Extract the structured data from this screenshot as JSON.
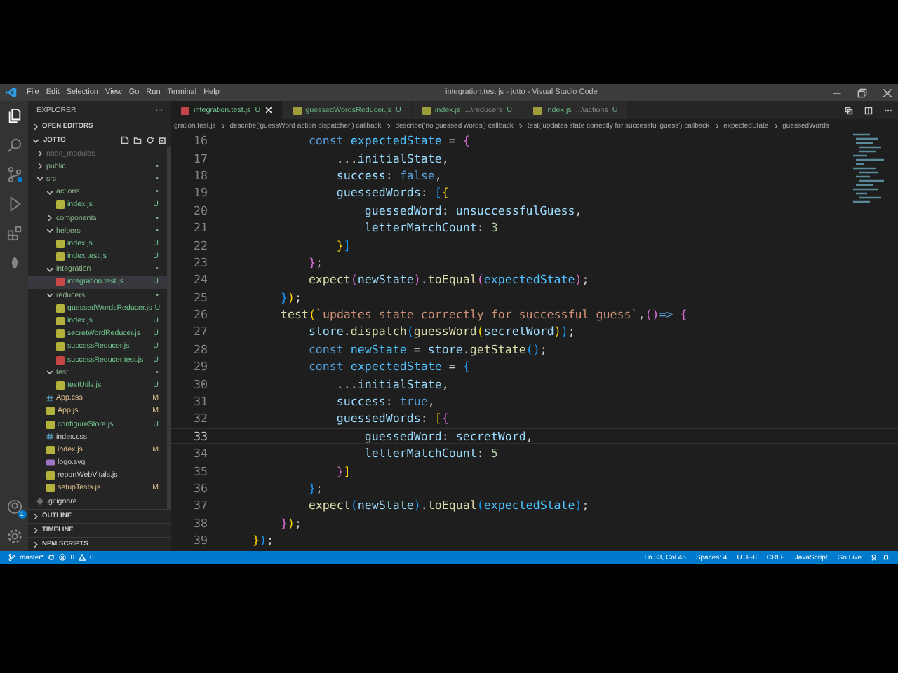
{
  "window": {
    "title": "integration.test.js - jotto - Visual Studio Code"
  },
  "menu": [
    "File",
    "Edit",
    "Selection",
    "View",
    "Go",
    "Run",
    "Terminal",
    "Help"
  ],
  "sidebar": {
    "title": "EXPLORER",
    "more": "···",
    "open_editors": "OPEN EDITORS",
    "project": "JOTTO",
    "tree": [
      {
        "name": "node_modules",
        "kind": "folder",
        "expanded": false,
        "selected": false,
        "color": "#6e6e6e"
      },
      {
        "name": "public",
        "kind": "folder",
        "expanded": false,
        "selected": false,
        "color": "#8db98d",
        "badge": "•"
      },
      {
        "name": "src",
        "kind": "folder",
        "expanded": true,
        "selected": false,
        "color": "#8db98d",
        "badge": "•",
        "children": [
          {
            "name": "actions",
            "kind": "folder",
            "expanded": true,
            "selected": false,
            "color": "#8db98d",
            "badge": "•",
            "children": [
              {
                "name": "index.js",
                "kind": "js",
                "selected": false,
                "color": "#73c991",
                "badge": "U"
              }
            ]
          },
          {
            "name": "components",
            "kind": "folder",
            "expanded": false,
            "selected": false,
            "color": "#8db98d",
            "badge": "•"
          },
          {
            "name": "helpers",
            "kind": "folder",
            "expanded": true,
            "selected": false,
            "color": "#8db98d",
            "badge": "•",
            "children": [
              {
                "name": "index.js",
                "kind": "js",
                "selected": false,
                "color": "#73c991",
                "badge": "U"
              },
              {
                "name": "index.test.js",
                "kind": "js",
                "selected": false,
                "color": "#73c991",
                "badge": "U"
              }
            ]
          },
          {
            "name": "integration",
            "kind": "folder",
            "expanded": true,
            "selected": false,
            "color": "#8db98d",
            "badge": "•",
            "children": [
              {
                "name": "integration.test.js",
                "kind": "test",
                "selected": true,
                "color": "#73c991",
                "badge": "U"
              }
            ]
          },
          {
            "name": "reducers",
            "kind": "folder",
            "expanded": true,
            "selected": false,
            "color": "#8db98d",
            "badge": "•",
            "children": [
              {
                "name": "guessedWordsReducer.js",
                "kind": "js",
                "selected": false,
                "color": "#73c991",
                "badge": "U"
              },
              {
                "name": "index.js",
                "kind": "js",
                "selected": false,
                "color": "#73c991",
                "badge": "U"
              },
              {
                "name": "secretWordReducer.js",
                "kind": "js",
                "selected": false,
                "color": "#73c991",
                "badge": "U"
              },
              {
                "name": "successReducer.js",
                "kind": "js",
                "selected": false,
                "color": "#73c991",
                "badge": "U"
              },
              {
                "name": "successReducer.test.js",
                "kind": "test",
                "selected": false,
                "color": "#73c991",
                "badge": "U"
              }
            ]
          },
          {
            "name": "test",
            "kind": "folder",
            "expanded": true,
            "selected": false,
            "color": "#8db98d",
            "badge": "•",
            "children": [
              {
                "name": "testUtils.js",
                "kind": "js",
                "selected": false,
                "color": "#73c991",
                "badge": "U"
              }
            ]
          },
          {
            "name": "App.css",
            "kind": "css",
            "selected": false,
            "color": "#e2c08d",
            "badge": "M"
          },
          {
            "name": "App.js",
            "kind": "js",
            "selected": false,
            "color": "#e2c08d",
            "badge": "M"
          },
          {
            "name": "configureStore.js",
            "kind": "js",
            "selected": false,
            "color": "#73c991",
            "badge": "U"
          },
          {
            "name": "index.css",
            "kind": "css",
            "selected": false,
            "color": "#cccccc"
          },
          {
            "name": "index.js",
            "kind": "js",
            "selected": false,
            "color": "#e2c08d",
            "badge": "M"
          },
          {
            "name": "logo.svg",
            "kind": "svg",
            "selected": false,
            "color": "#cccccc"
          },
          {
            "name": "reportWebVitals.js",
            "kind": "js",
            "selected": false,
            "color": "#cccccc"
          },
          {
            "name": "setupTests.js",
            "kind": "js",
            "selected": false,
            "color": "#e2c08d",
            "badge": "M"
          }
        ]
      },
      {
        "name": ".gitignore",
        "kind": "config",
        "selected": false,
        "color": "#cccccc"
      }
    ],
    "panels": [
      "OUTLINE",
      "TIMELINE",
      "NPM SCRIPTS"
    ]
  },
  "activity": {
    "accounts_badge": "1"
  },
  "tabs": [
    {
      "label": "integration.test.js",
      "badge": "U",
      "kind": "test",
      "selected": true
    },
    {
      "label": "guessedWordsReducer.js",
      "badge": "U",
      "kind": "js",
      "selected": false
    },
    {
      "label": "index.js",
      "description": "...\\reducers",
      "badge": "U",
      "kind": "js",
      "selected": false
    },
    {
      "label": "index.js",
      "description": "...\\actions",
      "badge": "U",
      "kind": "js",
      "selected": false
    }
  ],
  "breadcrumbs": [
    "gration.test.js",
    "describe('guessWord action dispatcher') callback",
    "describe('no guessed words') callback",
    "test('updates state correctly for successful guess') callback",
    "expectedState",
    "guessedWords"
  ],
  "code": [
    {
      "n": "16",
      "current": false,
      "tokens": [
        {
          "kind": "kw",
          "text": "            const "
        },
        {
          "kind": "const",
          "text": "expectedState"
        },
        {
          "kind": "p",
          "text": " = "
        },
        {
          "kind": "b2",
          "text": "{"
        }
      ]
    },
    {
      "n": "17",
      "current": false,
      "tokens": [
        {
          "kind": "p",
          "text": "                ..."
        },
        {
          "kind": "var",
          "text": "initialState"
        },
        {
          "kind": "p",
          "text": ","
        }
      ]
    },
    {
      "n": "18",
      "current": false,
      "tokens": [
        {
          "kind": "var",
          "text": "                success"
        },
        {
          "kind": "p",
          "text": ": "
        },
        {
          "kind": "kw",
          "text": "false"
        },
        {
          "kind": "p",
          "text": ","
        }
      ]
    },
    {
      "n": "19",
      "current": false,
      "tokens": [
        {
          "kind": "var",
          "text": "                guessedWords"
        },
        {
          "kind": "p",
          "text": ": "
        },
        {
          "kind": "b3",
          "text": "["
        },
        {
          "kind": "b1",
          "text": "{"
        }
      ]
    },
    {
      "n": "20",
      "current": false,
      "tokens": [
        {
          "kind": "var",
          "text": "                    guessedWord"
        },
        {
          "kind": "p",
          "text": ": "
        },
        {
          "kind": "var",
          "text": "unsuccessfulGuess"
        },
        {
          "kind": "p",
          "text": ","
        }
      ]
    },
    {
      "n": "21",
      "current": false,
      "tokens": [
        {
          "kind": "var",
          "text": "                    letterMatchCount"
        },
        {
          "kind": "p",
          "text": ": "
        },
        {
          "kind": "num",
          "text": "3"
        }
      ]
    },
    {
      "n": "22",
      "current": false,
      "tokens": [
        {
          "kind": "b1",
          "text": "                }"
        },
        {
          "kind": "b3",
          "text": "]"
        }
      ]
    },
    {
      "n": "23",
      "current": false,
      "tokens": [
        {
          "kind": "b2",
          "text": "            }"
        },
        {
          "kind": "p",
          "text": ";"
        }
      ]
    },
    {
      "n": "24",
      "current": false,
      "tokens": [
        {
          "kind": "fn",
          "text": "            expect"
        },
        {
          "kind": "b2",
          "text": "("
        },
        {
          "kind": "var",
          "text": "newState"
        },
        {
          "kind": "b2",
          "text": ")"
        },
        {
          "kind": "p",
          "text": "."
        },
        {
          "kind": "fn",
          "text": "toEqual"
        },
        {
          "kind": "b2",
          "text": "("
        },
        {
          "kind": "const",
          "text": "expectedState"
        },
        {
          "kind": "b2",
          "text": ")"
        },
        {
          "kind": "p",
          "text": ";"
        }
      ]
    },
    {
      "n": "25",
      "current": false,
      "tokens": [
        {
          "kind": "b3",
          "text": "        }"
        },
        {
          "kind": "b1",
          "text": ")"
        },
        {
          "kind": "p",
          "text": ";"
        }
      ]
    },
    {
      "n": "26",
      "current": false,
      "tokens": [
        {
          "kind": "fn",
          "text": "        test"
        },
        {
          "kind": "b1",
          "text": "("
        },
        {
          "kind": "str",
          "text": "`updates state correctly for successful guess`"
        },
        {
          "kind": "p",
          "text": ","
        },
        {
          "kind": "b2",
          "text": "()"
        },
        {
          "kind": "kw",
          "text": "=>"
        },
        {
          "kind": "b2",
          "text": " {"
        }
      ]
    },
    {
      "n": "27",
      "current": false,
      "tokens": [
        {
          "kind": "var",
          "text": "            store"
        },
        {
          "kind": "p",
          "text": "."
        },
        {
          "kind": "fn",
          "text": "dispatch"
        },
        {
          "kind": "b3",
          "text": "("
        },
        {
          "kind": "fn",
          "text": "guessWord"
        },
        {
          "kind": "b1",
          "text": "("
        },
        {
          "kind": "var",
          "text": "secretWord"
        },
        {
          "kind": "b1",
          "text": ")"
        },
        {
          "kind": "b3",
          "text": ")"
        },
        {
          "kind": "p",
          "text": ";"
        }
      ]
    },
    {
      "n": "28",
      "current": false,
      "tokens": [
        {
          "kind": "kw",
          "text": "            const "
        },
        {
          "kind": "const",
          "text": "newState"
        },
        {
          "kind": "p",
          "text": " = "
        },
        {
          "kind": "var",
          "text": "store"
        },
        {
          "kind": "p",
          "text": "."
        },
        {
          "kind": "fn",
          "text": "getState"
        },
        {
          "kind": "b3",
          "text": "()"
        },
        {
          "kind": "p",
          "text": ";"
        }
      ]
    },
    {
      "n": "29",
      "current": false,
      "tokens": [
        {
          "kind": "kw",
          "text": "            const "
        },
        {
          "kind": "const",
          "text": "expectedState"
        },
        {
          "kind": "p",
          "text": " = "
        },
        {
          "kind": "b3",
          "text": "{"
        }
      ]
    },
    {
      "n": "30",
      "current": false,
      "tokens": [
        {
          "kind": "p",
          "text": "                ..."
        },
        {
          "kind": "var",
          "text": "initialState"
        },
        {
          "kind": "p",
          "text": ","
        }
      ]
    },
    {
      "n": "31",
      "current": false,
      "tokens": [
        {
          "kind": "var",
          "text": "                success"
        },
        {
          "kind": "p",
          "text": ": "
        },
        {
          "kind": "kw",
          "text": "true"
        },
        {
          "kind": "p",
          "text": ","
        }
      ]
    },
    {
      "n": "32",
      "current": false,
      "tokens": [
        {
          "kind": "var",
          "text": "                guessedWords"
        },
        {
          "kind": "p",
          "text": ": "
        },
        {
          "kind": "b1",
          "text": "["
        },
        {
          "kind": "b2",
          "text": "{"
        }
      ]
    },
    {
      "n": "33",
      "current": true,
      "tokens": [
        {
          "kind": "var",
          "text": "                    guessedWord"
        },
        {
          "kind": "p",
          "text": ": "
        },
        {
          "kind": "var",
          "text": "secretWord"
        },
        {
          "kind": "p",
          "text": ","
        }
      ]
    },
    {
      "n": "34",
      "current": false,
      "tokens": [
        {
          "kind": "var",
          "text": "                    letterMatchCount"
        },
        {
          "kind": "p",
          "text": ": "
        },
        {
          "kind": "num",
          "text": "5"
        }
      ]
    },
    {
      "n": "35",
      "current": false,
      "tokens": [
        {
          "kind": "b2",
          "text": "                }"
        },
        {
          "kind": "b1",
          "text": "]"
        }
      ]
    },
    {
      "n": "36",
      "current": false,
      "tokens": [
        {
          "kind": "b3",
          "text": "            }"
        },
        {
          "kind": "p",
          "text": ";"
        }
      ]
    },
    {
      "n": "37",
      "current": false,
      "tokens": [
        {
          "kind": "fn",
          "text": "            expect"
        },
        {
          "kind": "b3",
          "text": "("
        },
        {
          "kind": "var",
          "text": "newState"
        },
        {
          "kind": "b3",
          "text": ")"
        },
        {
          "kind": "p",
          "text": "."
        },
        {
          "kind": "fn",
          "text": "toEqual"
        },
        {
          "kind": "b3",
          "text": "("
        },
        {
          "kind": "const",
          "text": "expectedState"
        },
        {
          "kind": "b3",
          "text": ")"
        },
        {
          "kind": "p",
          "text": ";"
        }
      ]
    },
    {
      "n": "38",
      "current": false,
      "tokens": [
        {
          "kind": "b2",
          "text": "        }"
        },
        {
          "kind": "b1",
          "text": ")"
        },
        {
          "kind": "p",
          "text": ";"
        }
      ]
    },
    {
      "n": "39",
      "current": false,
      "tokens": [
        {
          "kind": "b1",
          "text": "    }"
        },
        {
          "kind": "b3",
          "text": ")"
        },
        {
          "kind": "p",
          "text": ";"
        }
      ]
    }
  ],
  "status_bar": {
    "branch": "master*",
    "errors": "0",
    "warnings": "0",
    "right": [
      "Ln 33, Col 45",
      "Spaces: 4",
      "UTF-8",
      "CRLF",
      "JavaScript",
      "Go Live"
    ]
  }
}
